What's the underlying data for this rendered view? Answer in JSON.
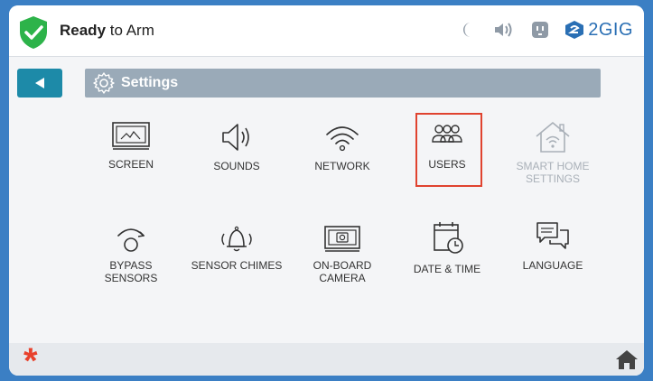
{
  "status": {
    "ready_bold": "Ready",
    "ready_rest": " to Arm",
    "icons": [
      "moon-icon",
      "speaker-icon",
      "outlet-icon"
    ],
    "brand": "2GIG",
    "shield_color": "#2db34a"
  },
  "header": {
    "back_icon": "back-arrow-icon",
    "title": "Settings",
    "title_icon": "gear-icon",
    "accent": "#1d8aa8",
    "bar_color": "#9aaab8"
  },
  "tiles": [
    {
      "id": "screen",
      "label": "SCREEN",
      "icon": "monitor-icon"
    },
    {
      "id": "sounds",
      "label": "SOUNDS",
      "icon": "speaker-icon"
    },
    {
      "id": "network",
      "label": "NETWORK",
      "icon": "wifi-icon"
    },
    {
      "id": "users",
      "label": "USERS",
      "icon": "users-icon",
      "highlighted": true
    },
    {
      "id": "smart-home",
      "label": "SMART HOME SETTINGS",
      "icon": "smart-home-icon",
      "disabled": true
    },
    {
      "id": "bypass",
      "label": "BYPASS SENSORS",
      "icon": "bypass-icon"
    },
    {
      "id": "chimes",
      "label": "SENSOR CHIMES",
      "icon": "bell-icon"
    },
    {
      "id": "camera",
      "label": "ON-BOARD CAMERA",
      "icon": "camera-icon"
    },
    {
      "id": "datetime",
      "label": "DATE & TIME",
      "icon": "calendar-clock-icon"
    },
    {
      "id": "language",
      "label": "LANGUAGE",
      "icon": "chat-icon"
    }
  ],
  "labels": {
    "screen": "SCREEN",
    "sounds": "SOUNDS",
    "network": "NETWORK",
    "users": "USERS",
    "smart_home_1": "SMART HOME",
    "smart_home_2": "SETTINGS",
    "bypass_1": "BYPASS",
    "bypass_2": "SENSORS",
    "chimes": "SENSOR CHIMES",
    "camera_1": "ON-BOARD",
    "camera_2": "CAMERA",
    "datetime": "DATE & TIME",
    "language": "LANGUAGE"
  },
  "footer": {
    "asterisk": "*",
    "asterisk_color": "#e8412c",
    "home_icon": "home-icon"
  }
}
